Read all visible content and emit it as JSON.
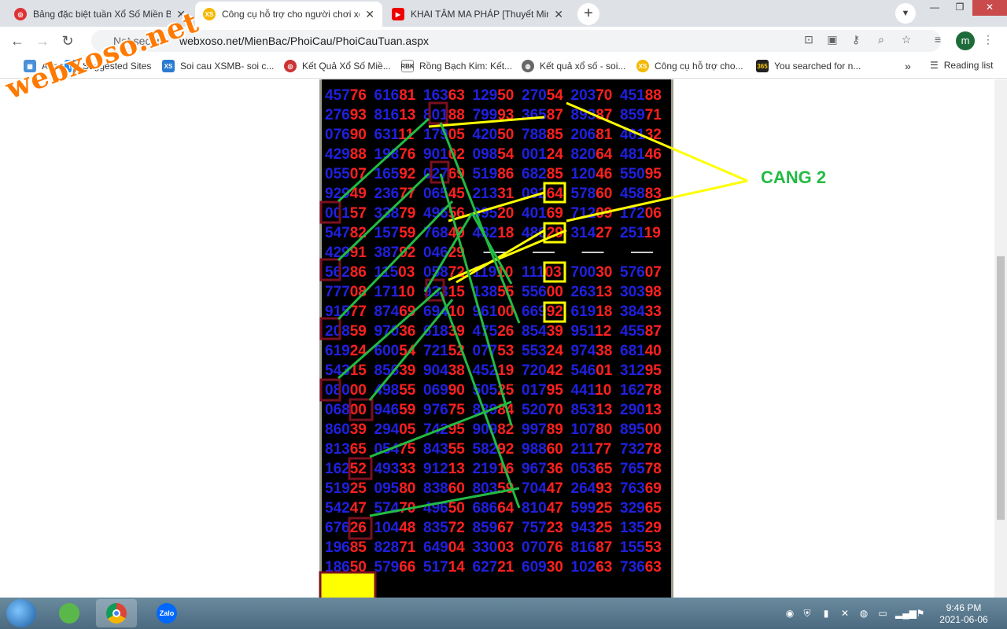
{
  "tabs": [
    {
      "title": "Bảng đặc biệt tuần Xổ Số Miền Bắc",
      "icon": "lottery-icon",
      "active": false
    },
    {
      "title": "Công cụ hỗ trợ cho người chơi xổ số",
      "icon": "xs-icon",
      "active": true
    },
    {
      "title": "KHAI TÂM MA PHÁP [Thuyết Minh]",
      "icon": "youtube-icon",
      "active": false
    }
  ],
  "toolbar": {
    "security": "Not secure",
    "url": "webxoso.net/MienBac/PhoiCau/PhoiCauTuan.aspx",
    "avatar": "m"
  },
  "bookmarks": [
    {
      "label": "Apps",
      "icon": "apps-icon"
    },
    {
      "label": "Suggested Sites",
      "icon": "bing-icon"
    },
    {
      "label": "Soi cau XSMB- soi c...",
      "icon": "xs-icon"
    },
    {
      "label": "Kết Quả Xổ Số Miề...",
      "icon": "lottery-icon"
    },
    {
      "label": "Rồng Bạch Kim: Kết...",
      "icon": "rbk-icon"
    },
    {
      "label": "Kết quả xổ số - soi...",
      "icon": "globe-icon"
    },
    {
      "label": "Công cụ hỗ trợ cho...",
      "icon": "xs-icon"
    },
    {
      "label": "You searched for n...",
      "icon": "365-icon"
    }
  ],
  "reading_list": "Reading list",
  "more_bookmarks": "»",
  "watermark": "webxoso.net",
  "annotation": "CANG 2",
  "grid_rows": [
    [
      "45776",
      "61681",
      "16363",
      "12950",
      "27054",
      "20370",
      "45188"
    ],
    [
      "27693",
      "81613",
      "80188",
      "79993",
      "36587",
      "89387",
      "85971"
    ],
    [
      "07690",
      "63111",
      "17905",
      "42050",
      "78885",
      "20681",
      "46132"
    ],
    [
      "42988",
      "19876",
      "90102",
      "09854",
      "00124",
      "82064",
      "48146"
    ],
    [
      "05507",
      "16592",
      "02769",
      "51986",
      "68285",
      "12046",
      "55095"
    ],
    [
      "92949",
      "23677",
      "06545",
      "21331",
      "09264",
      "57860",
      "45883"
    ],
    [
      "00157",
      "33879",
      "49656",
      "09520",
      "40169",
      "71209",
      "17206"
    ],
    [
      "54782",
      "15759",
      "76849",
      "48218",
      "48629",
      "31427",
      "25119"
    ],
    [
      "42991",
      "38792",
      "04629",
      "",
      "",
      "",
      ""
    ],
    [
      "56286",
      "11503",
      "05872",
      "11910",
      "11103",
      "70030",
      "57607"
    ],
    [
      "77708",
      "17110",
      "93315",
      "13855",
      "55600",
      "26313",
      "30398"
    ],
    [
      "91577",
      "87469",
      "69410",
      "96100",
      "66992",
      "61918",
      "38433"
    ],
    [
      "20859",
      "97036",
      "61839",
      "47526",
      "85439",
      "95112",
      "45587"
    ],
    [
      "61924",
      "60054",
      "72152",
      "07753",
      "55324",
      "97438",
      "68140"
    ],
    [
      "54315",
      "85639",
      "90438",
      "45219",
      "72042",
      "54601",
      "31295"
    ],
    [
      "08000",
      "49855",
      "06990",
      "50525",
      "01795",
      "44110",
      "16278"
    ],
    [
      "06800",
      "94659",
      "97675",
      "83984",
      "52070",
      "85313",
      "29013"
    ],
    [
      "86039",
      "29405",
      "74295",
      "90982",
      "99789",
      "10780",
      "89500"
    ],
    [
      "81365",
      "05475",
      "84355",
      "58292",
      "98860",
      "21177",
      "73278"
    ],
    [
      "16252",
      "49333",
      "91213",
      "21916",
      "96736",
      "05365",
      "76578"
    ],
    [
      "51925",
      "09580",
      "83860",
      "80359",
      "70447",
      "26493",
      "76369"
    ],
    [
      "54247",
      "57470",
      "49650",
      "68664",
      "81047",
      "59925",
      "32965"
    ],
    [
      "67626",
      "10448",
      "83572",
      "85967",
      "75723",
      "94325",
      "13529"
    ],
    [
      "19685",
      "82871",
      "64904",
      "33003",
      "07076",
      "81687",
      "15553"
    ],
    [
      "18650",
      "57966",
      "51714",
      "62721",
      "60930",
      "10263",
      "73663"
    ]
  ],
  "taskbar": {
    "time": "9:46 PM",
    "date": "2021-06-06"
  },
  "colors": {
    "blue": "#2020e0",
    "red": "#ff2020",
    "green": "#22bb44",
    "yellow": "#ffff00",
    "box": "#7a1020"
  }
}
